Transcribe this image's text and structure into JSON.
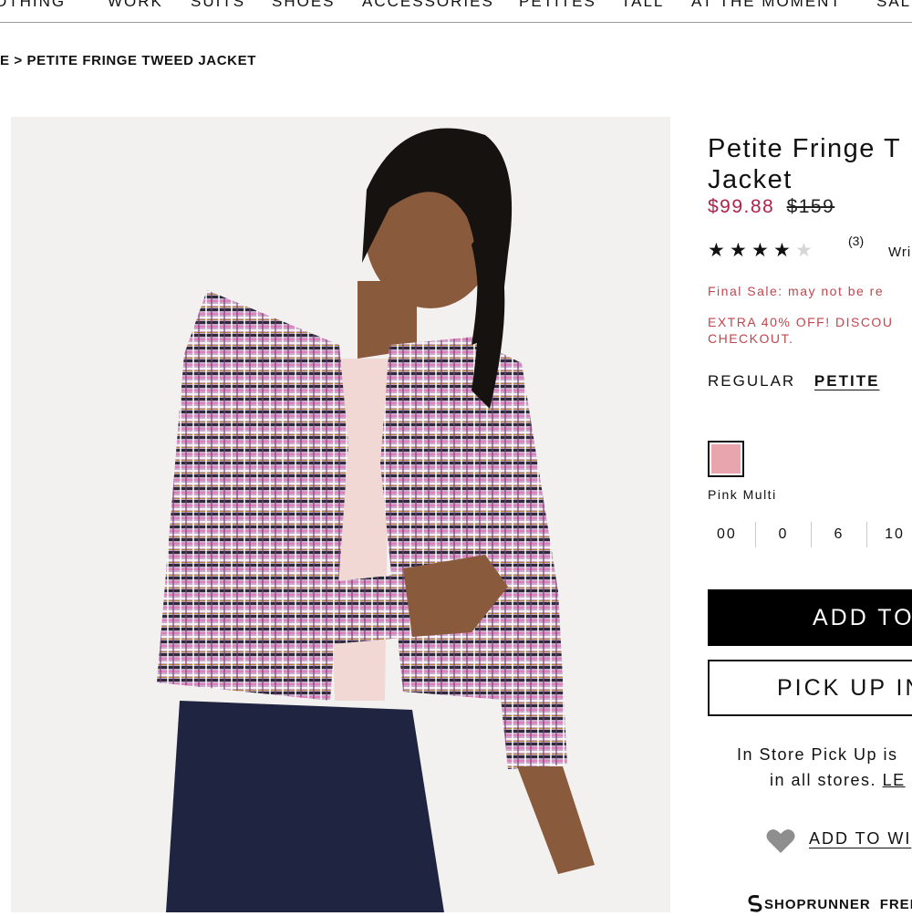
{
  "nav": {
    "items": [
      "OTHING",
      "WORK",
      "SUITS",
      "SHOES",
      "ACCESSORIES",
      "PETITES",
      "TALL",
      "AT THE MOMENT",
      "SAL"
    ]
  },
  "breadcrumb": {
    "prefix": "E >",
    "current": "PETITE FRINGE TWEED JACKET"
  },
  "product": {
    "title_line1": "Petite Fringe T",
    "title_line2": "Jacket",
    "sale_price": "$99.88",
    "original_price": "$159",
    "rating": {
      "value": 4,
      "max": 5,
      "count": "(3)",
      "write_label": "Wri"
    },
    "final_sale": "Final Sale: may not be re",
    "promo_line1": "EXTRA 40% OFF! DISCOU",
    "promo_line2": "CHECKOUT.",
    "fit_options": [
      "REGULAR",
      "PETITE"
    ],
    "selected_fit": "PETITE",
    "color": {
      "name": "Pink Multi",
      "swatch": "#e8a5ab"
    },
    "sizes": [
      "00",
      "0",
      "6",
      "10"
    ]
  },
  "actions": {
    "add_to_bag": "ADD TO",
    "pick_up": "PICK UP IN",
    "pickup_info_line1": "In Store Pick Up is",
    "pickup_info_line2_prefix": "in all stores.",
    "learn_more": "LE",
    "wishlist": "ADD TO WI"
  },
  "shoprunner": {
    "brand": "SHOPRUNNER",
    "free": "FREE"
  },
  "colors": {
    "sale": "#b0224a",
    "notice": "#c0464e",
    "button": "#000000"
  }
}
